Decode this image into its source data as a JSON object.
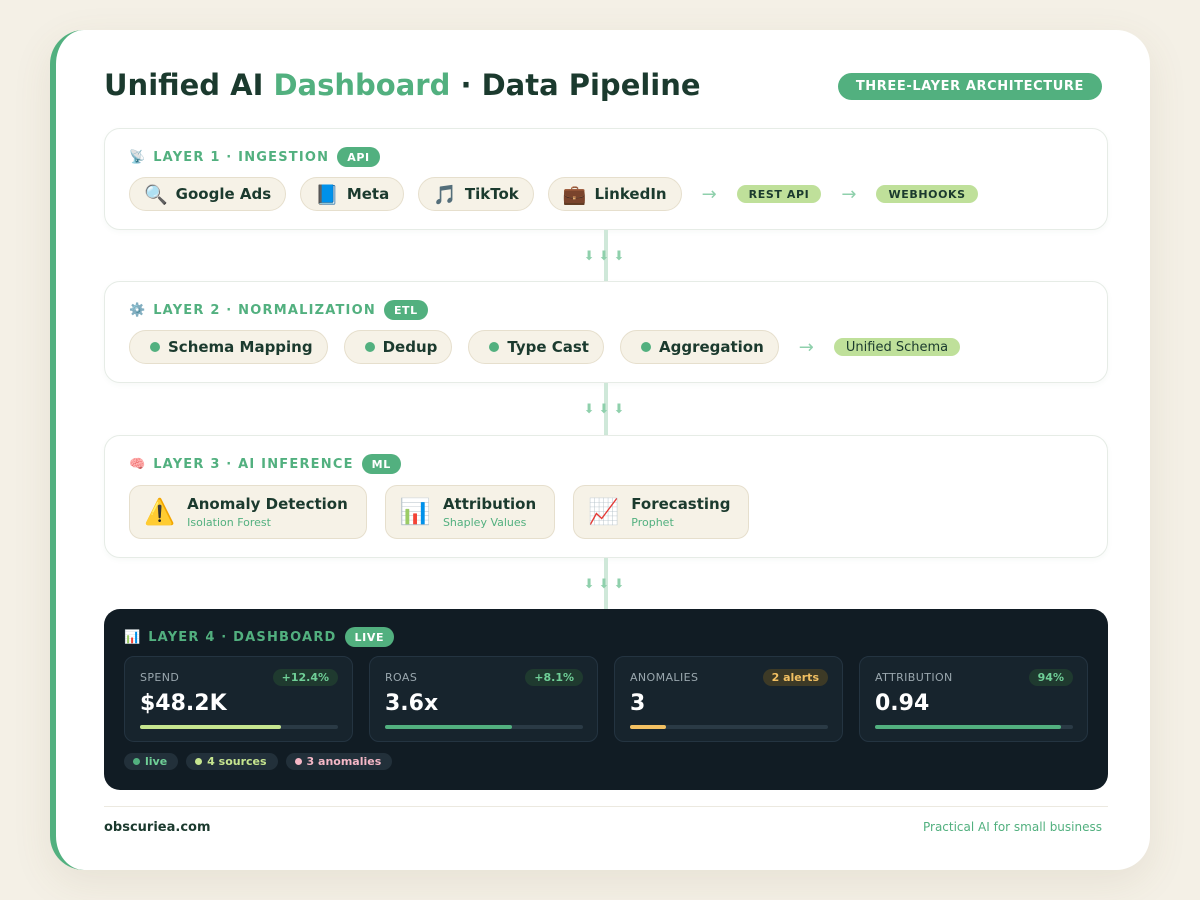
{
  "header": {
    "title_pre": "Unified AI ",
    "title_accent": "Dashboard",
    "title_post": " · Data Pipeline",
    "badge": "THREE-LAYER ARCHITECTURE"
  },
  "layer1": {
    "icon": "📡",
    "label": "LAYER 1 · INGESTION",
    "tag": "API",
    "sources": [
      {
        "icon": "🔍",
        "name": "Google Ads"
      },
      {
        "icon": "📘",
        "name": "Meta"
      },
      {
        "icon": "🎵",
        "name": "TikTok"
      },
      {
        "icon": "💼",
        "name": "LinkedIn"
      }
    ],
    "arrow": "→",
    "outputs": [
      "REST API",
      "WEBHOOKS"
    ]
  },
  "layer2": {
    "icon": "⚙️",
    "label": "LAYER 2 · NORMALIZATION",
    "tag": "ETL",
    "steps": [
      "Schema Mapping",
      "Dedup",
      "Type Cast",
      "Aggregation"
    ],
    "arrow": "→",
    "output": "Unified Schema"
  },
  "layer3": {
    "icon": "🧠",
    "label": "LAYER 3 · AI INFERENCE",
    "tag": "ML",
    "models": [
      {
        "icon": "⚠️",
        "name": "Anomaly Detection",
        "algo": "Isolation Forest"
      },
      {
        "icon": "📊",
        "name": "Attribution",
        "algo": "Shapley Values"
      },
      {
        "icon": "📈",
        "name": "Forecasting",
        "algo": "Prophet"
      }
    ]
  },
  "connector": {
    "arrows": "⬇⬇⬇"
  },
  "layer4": {
    "icon": "📊",
    "label": "LAYER 4 · DASHBOARD",
    "tag": "LIVE",
    "kpis": [
      {
        "label": "SPEND",
        "delta": "+12.4%",
        "value": "$48.2K",
        "progress": 0.71,
        "color": "#c6e58f"
      },
      {
        "label": "ROAS",
        "delta": "+8.1%",
        "value": "3.6x",
        "progress": 0.64,
        "color": "#52b07f"
      },
      {
        "label": "ANOMALIES",
        "delta": "2 alerts",
        "value": "3",
        "progress": 0.18,
        "color": "#f2c062"
      },
      {
        "label": "ATTRIBUTION",
        "delta": "94%",
        "value": "0.94",
        "progress": 0.94,
        "color": "#52b07f"
      }
    ],
    "status": [
      {
        "text": "live",
        "color": "#52b07f",
        "text_color": "#6fcf97"
      },
      {
        "text": "4 sources",
        "color": "#c6e58f",
        "text_color": "#c6e58f"
      },
      {
        "text": "3 anomalies",
        "color": "#f5b7c6",
        "text_color": "#f5b7c6"
      }
    ]
  },
  "footer": {
    "site": "obscuriea.com",
    "tagline": "Practical AI for small business"
  },
  "colors": {
    "accent": "#52b07f",
    "dark": "#111c24",
    "cream": "#f4f0e6"
  }
}
